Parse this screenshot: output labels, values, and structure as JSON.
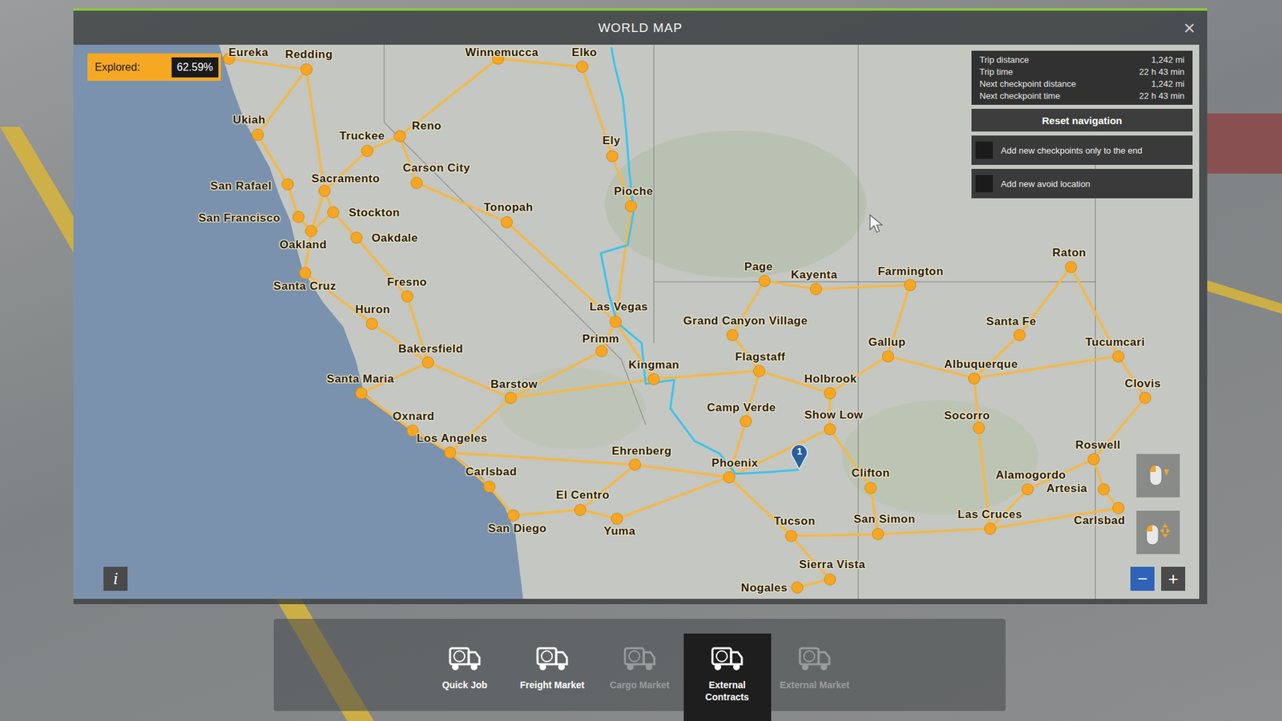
{
  "window": {
    "title": "WORLD MAP",
    "close": "×"
  },
  "explored": {
    "label": "Explored:",
    "value": "62.59%"
  },
  "trip_info": [
    {
      "label": "Trip distance",
      "value": "1,242 mi"
    },
    {
      "label": "Trip time",
      "value": "22 h 43 min"
    },
    {
      "label": "Next checkpoint distance",
      "value": "1,242 mi"
    },
    {
      "label": "Next checkpoint time",
      "value": "22 h 43 min"
    }
  ],
  "navigation": {
    "reset": "Reset navigation",
    "options": [
      {
        "label": "Add new checkpoints only to the end",
        "checked": false
      },
      {
        "label": "Add new avoid location",
        "checked": false
      }
    ]
  },
  "map": {
    "cities": [
      "Eureka",
      "Redding",
      "Winnemucca",
      "Elko",
      "Ukiah",
      "Truckee",
      "Reno",
      "Carson City",
      "Sacramento",
      "San Rafael",
      "San Francisco",
      "Stockton",
      "Oakland",
      "Oakdale",
      "Santa Cruz",
      "Fresno",
      "Huron",
      "Bakersfield",
      "Santa Maria",
      "Oxnard",
      "Los Angeles",
      "Carlsbad",
      "San Diego",
      "Barstow",
      "El Centro",
      "Yuma",
      "Ehrenberg",
      "Tonopah",
      "Ely",
      "Pioche",
      "Las Vegas",
      "Primm",
      "Kingman",
      "Grand Canyon Village",
      "Page",
      "Kayenta",
      "Flagstaff",
      "Camp Verde",
      "Phoenix",
      "Holbrook",
      "Show Low",
      "Farmington",
      "Gallup",
      "Albuquerque",
      "Santa Fe",
      "Raton",
      "Tucumcari",
      "Clovis",
      "Socorro",
      "Roswell",
      "Alamogordo",
      "Artesia",
      "Carlsbad",
      "Las Cruces",
      "Clifton",
      "Tucson",
      "San Simon",
      "Sierra Vista",
      "Nogales"
    ],
    "checkpoint": {
      "label": "1"
    }
  },
  "controls": {
    "info": "i",
    "zoom_out": "−",
    "zoom_in": "+"
  },
  "menu": [
    {
      "label": "Quick Job",
      "selected": false,
      "disabled": false
    },
    {
      "label": "Freight Market",
      "selected": false,
      "disabled": false
    },
    {
      "label": "Cargo Market",
      "selected": false,
      "disabled": true
    },
    {
      "label": "External Contracts",
      "selected": true,
      "disabled": false
    },
    {
      "label": "External Market",
      "selected": false,
      "disabled": true
    }
  ]
}
